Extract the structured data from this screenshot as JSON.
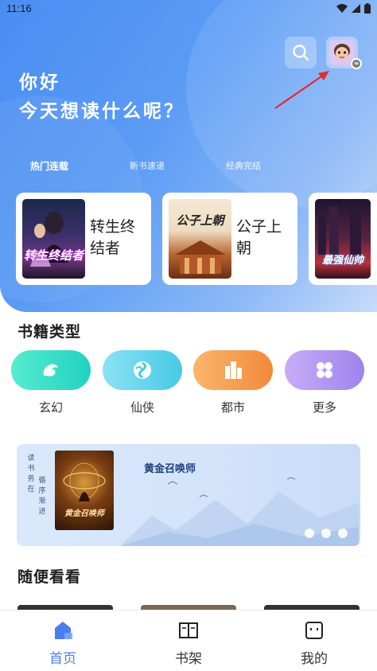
{
  "status_bar": {
    "time": "11:16"
  },
  "header": {
    "greeting": "你好",
    "prompt": "今天想读什么呢？",
    "search_icon": "search-icon",
    "avatar_icon": "user-avatar"
  },
  "hero_tabs": [
    {
      "label": "热门连载",
      "active": true
    },
    {
      "label": "新书速递",
      "active": false
    },
    {
      "label": "经典完结",
      "active": false
    }
  ],
  "featured_books": [
    {
      "title": "转生终结者",
      "cover_text": "转生终结者"
    },
    {
      "title": "公子上朝",
      "cover_text": "公子上朝"
    },
    {
      "title": "",
      "cover_text": "最强仙帅"
    }
  ],
  "categories_section": {
    "title": "书籍类型",
    "items": [
      {
        "label": "玄幻",
        "icon": "dragon-icon",
        "color": "#2fd8c4"
      },
      {
        "label": "仙侠",
        "icon": "swirl-icon",
        "color": "#5fd3ea"
      },
      {
        "label": "都市",
        "icon": "city-icon",
        "color": "#f49b4a"
      },
      {
        "label": "更多",
        "icon": "grid-icon",
        "color": "#b497f3"
      }
    ]
  },
  "banner": {
    "side_text": [
      "读书务在",
      "循序渐进"
    ],
    "book_title": "黄金召唤师",
    "cover_text": "黄金召唤师",
    "dots": 3
  },
  "browse_section": {
    "title": "随便看看"
  },
  "bottom_nav": [
    {
      "label": "首页",
      "icon": "home-icon",
      "active": true
    },
    {
      "label": "书架",
      "icon": "book-icon",
      "active": false
    },
    {
      "label": "我的",
      "icon": "profile-icon",
      "active": false
    }
  ],
  "colors": {
    "accent": "#4a7df0",
    "hero_start": "#4a8df2",
    "hero_end": "#c8dbf9"
  }
}
